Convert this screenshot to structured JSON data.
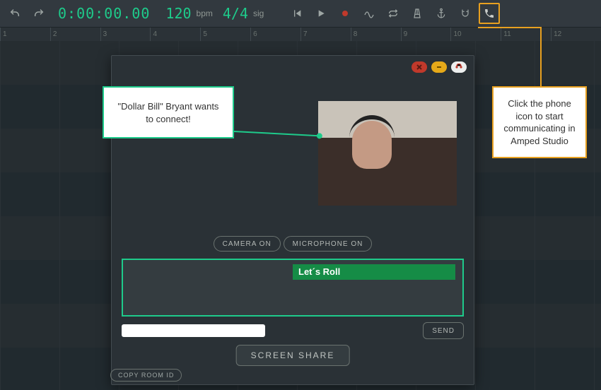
{
  "toolbar": {
    "time": "0:00:00.00",
    "tempo": "120",
    "tempo_unit": "bpm",
    "signature": "4/4",
    "signature_unit": "sig"
  },
  "ruler": {
    "ticks": [
      "1",
      "2",
      "3",
      "4",
      "5",
      "6",
      "7",
      "8",
      "9",
      "10",
      "11",
      "12"
    ]
  },
  "call_panel": {
    "camera_btn": "CAMERA ON",
    "mic_btn": "MICROPHONE ON",
    "chat_message": "Let´s Roll",
    "send_btn": "SEND",
    "screen_share_btn": "SCREEN SHARE",
    "copy_room_btn": "COPY ROOM ID"
  },
  "callout": {
    "text": "\"Dollar Bill\" Bryant wants to connect!"
  },
  "orange_note": {
    "text": "Click the phone icon to start communicating in Amped Studio"
  }
}
